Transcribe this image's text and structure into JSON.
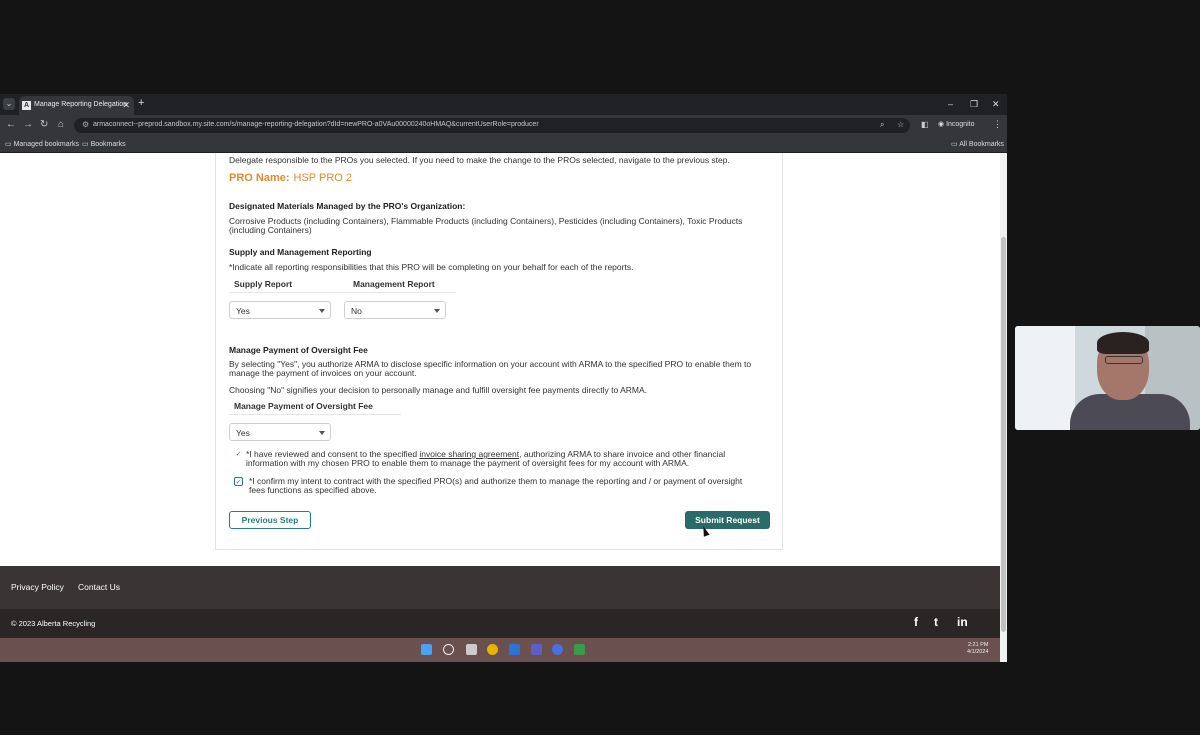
{
  "browser": {
    "tab_title": "Manage Reporting Delegation",
    "tab_favicon": "A",
    "url": "armaconnect--preprod.sandbox.my.site.com/s/manage-reporting-delegation?dId=newPRO-a0VAu00000240oHMAQ&currentUserRole=producer",
    "incognito_label": "Incognito",
    "bookmarks": [
      "Managed bookmarks",
      "Bookmarks"
    ],
    "all_bookmarks": "All Bookmarks"
  },
  "page": {
    "intro": "Delegate responsible to the PROs you selected. If you need to make the change to the PROs selected, navigate to the previous step.",
    "pro_name_label": "PRO Name:",
    "pro_name_value": "HSP PRO 2",
    "materials_heading": "Designated Materials Managed by the PRO's Organization:",
    "materials_line1": "Corrosive Products (including Containers), Flammable Products (including Containers), Pesticides (including Containers), Toxic Products",
    "materials_line2": "(including Containers)",
    "reporting_heading": "Supply and Management Reporting",
    "reporting_instruction": "*Indicate all reporting responsibilities that this PRO will be completing on your behalf for each of the reports.",
    "supply_report_header": "Supply Report",
    "management_report_header": "Management Report",
    "supply_report_value": "Yes",
    "management_report_value": "No",
    "oversight_heading": "Manage Payment of Oversight Fee",
    "oversight_text_line1": "By selecting \"Yes\", you authorize ARMA to disclose specific information on your account with ARMA to the specified PRO to enable them to",
    "oversight_text_line2": "manage the payment of invoices on your account.",
    "oversight_choosing_no": "Choosing \"No\" signifies your decision to personally manage and fulfill oversight fee payments directly to ARMA.",
    "oversight_column_header": "Manage Payment of Oversight Fee",
    "oversight_value": "Yes",
    "consent_part1": "*I have reviewed and consent to the specified ",
    "consent_link": "invoice sharing agreement",
    "consent_part2": ", authorizing ARMA to share invoice and other financial",
    "consent_line2": "information with my chosen PRO to enable them to manage the payment of oversight fees for my account with ARMA.",
    "confirm_line1": "*I confirm my intent to contract with the specified PRO(s) and authorize them to manage the reporting and / or payment of oversight",
    "confirm_line2": "fees functions as specified above.",
    "previous_button": "Previous Step",
    "submit_button": "Submit Request"
  },
  "footer": {
    "privacy": "Privacy Policy",
    "contact": "Contact Us",
    "copyright": "© 2023 Alberta Recycling",
    "social": [
      "f",
      "t",
      "in"
    ]
  },
  "taskbar": {
    "time": "2:21 PM",
    "date": "4/1/2024"
  },
  "colors": {
    "accent": "#2a6b69",
    "pro_name": "#e08a2e"
  }
}
